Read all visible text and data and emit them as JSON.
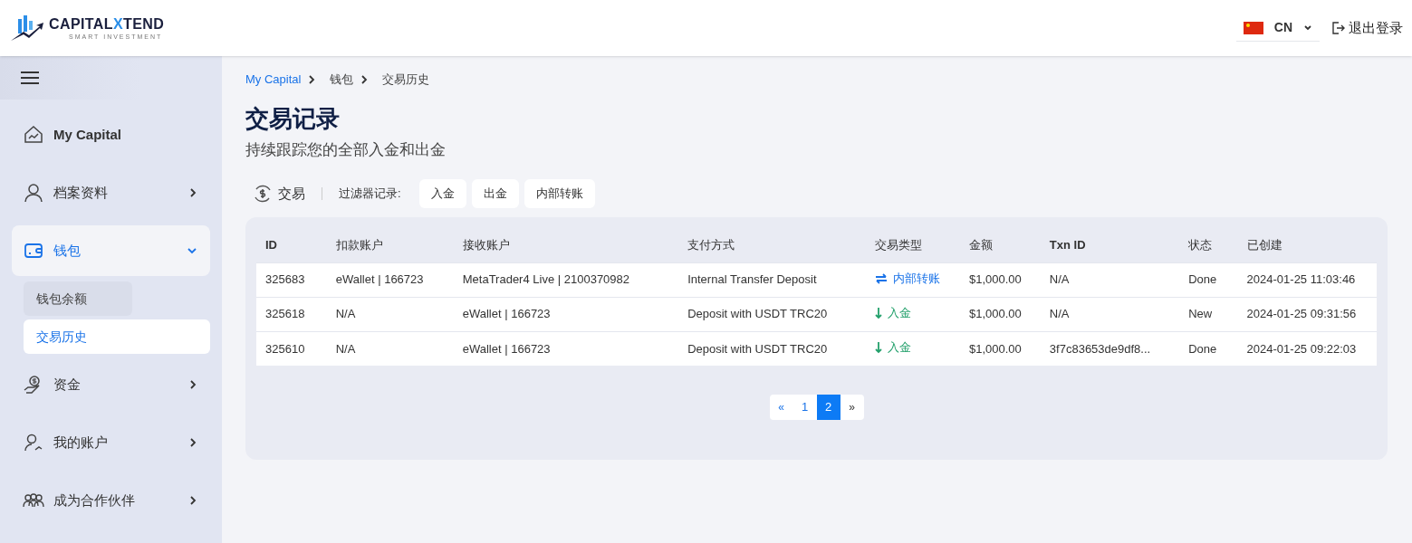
{
  "header": {
    "logo": {
      "before": "CAPITAL",
      "accent": "X",
      "after": "TEND",
      "tagline": "SMART INVESTMENT"
    },
    "language": "CN",
    "logout": "退出登录"
  },
  "sidebar": {
    "items": [
      {
        "label": "My Capital",
        "selected": false,
        "has_arrow": false
      },
      {
        "label": "档案资料",
        "expanded": false,
        "selected": false,
        "has_arrow": true
      },
      {
        "label": "钱包",
        "expanded": true,
        "selected": true,
        "has_arrow": true,
        "children": [
          {
            "label": "钱包余额",
            "selected": false
          },
          {
            "label": "交易历史",
            "selected": true
          }
        ]
      },
      {
        "label": "资金",
        "expanded": false,
        "selected": false,
        "has_arrow": true
      },
      {
        "label": "我的账户",
        "expanded": false,
        "selected": false,
        "has_arrow": true
      },
      {
        "label": "成为合作伙伴",
        "expanded": false,
        "selected": false,
        "has_arrow": true
      }
    ]
  },
  "breadcrumb": [
    "My Capital",
    "钱包",
    "交易历史"
  ],
  "title": "交易记录",
  "subtitle": "持续跟踪您的全部入金和出金",
  "filter": {
    "section": "交易",
    "label": "过滤器记录:",
    "buttons": [
      "入金",
      "出金",
      "内部转账"
    ]
  },
  "table": {
    "columns": [
      "ID",
      "扣款账户",
      "接收账户",
      "支付方式",
      "交易类型",
      "金额",
      "Txn ID",
      "状态",
      "已创建"
    ],
    "rows": [
      {
        "id": "325683",
        "from": "eWallet | 166723",
        "to": "MetaTrader4 Live | 2100370982",
        "method": "Internal Transfer Deposit",
        "type": {
          "kind": "transfer",
          "label": "内部转账"
        },
        "amount": "$1,000.00",
        "txn": "N/A",
        "status": "Done",
        "created": "2024-01-25 11:03:46"
      },
      {
        "id": "325618",
        "from": "N/A",
        "to": "eWallet | 166723",
        "method": "Deposit with USDT TRC20",
        "type": {
          "kind": "deposit",
          "label": "入金"
        },
        "amount": "$1,000.00",
        "txn": "N/A",
        "status": "New",
        "created": "2024-01-25 09:31:56"
      },
      {
        "id": "325610",
        "from": "N/A",
        "to": "eWallet | 166723",
        "method": "Deposit with USDT TRC20",
        "type": {
          "kind": "deposit",
          "label": "入金"
        },
        "amount": "$1,000.00",
        "txn": "3f7c83653de9df8...",
        "status": "Done",
        "created": "2024-01-25 09:22:03"
      }
    ]
  },
  "pagination": {
    "prev": "«",
    "pages": [
      {
        "label": "1",
        "selected": false
      },
      {
        "label": "2",
        "selected": true
      }
    ],
    "next": "»"
  }
}
